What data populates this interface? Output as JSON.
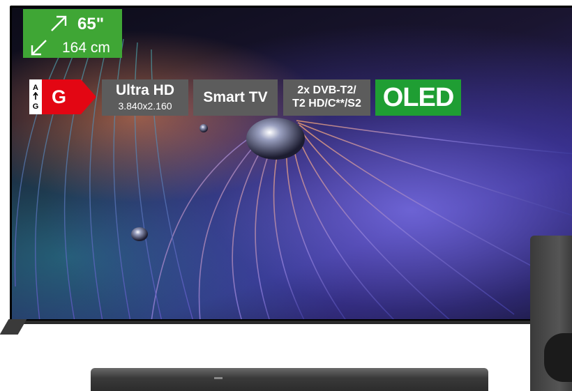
{
  "tv": {
    "screen_size": {
      "inches": "65\"",
      "cm": "164 cm",
      "badge_color": "#3fa635"
    },
    "energy_label": {
      "scale_top": "A",
      "scale_bottom": "G",
      "class": "G",
      "class_color": "#e30613"
    },
    "badges": {
      "uhd_title": "Ultra HD",
      "uhd_resolution": "3.840x2.160",
      "smart": "Smart TV",
      "tuner_line1": "2x DVB-T2/",
      "tuner_line2": "T2 HD/C**/S2",
      "oled": "OLED",
      "grey_color": "#5c5c5c",
      "oled_color": "#1f9e33"
    }
  },
  "icons": {
    "arrow_up_right": "arrow-up-right-icon",
    "arrow_down_left": "arrow-down-left-icon",
    "arrow_up_small": "arrow-up-icon"
  }
}
